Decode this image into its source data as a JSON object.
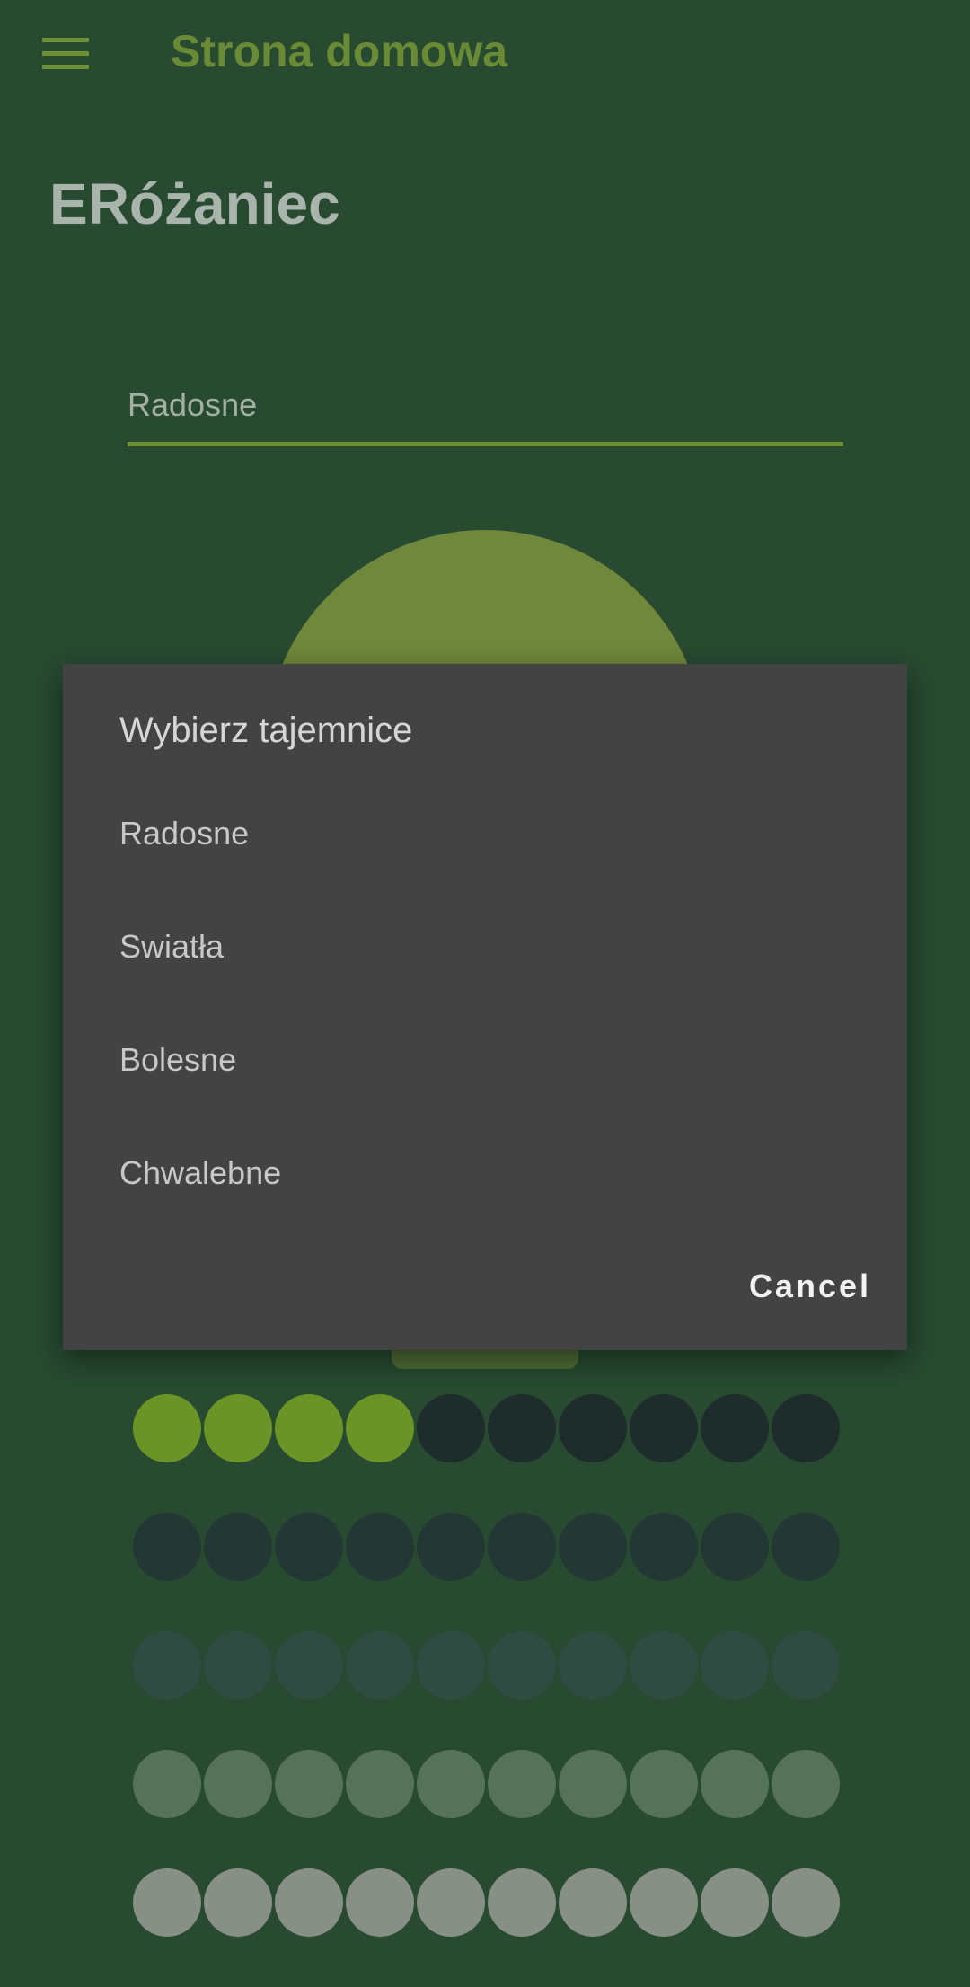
{
  "appbar": {
    "title": "Strona domowa",
    "menu_icon": "hamburger-menu-icon"
  },
  "page": {
    "title": "ERóżaniec"
  },
  "mystery_select": {
    "value": "Radosne"
  },
  "dialog": {
    "title": "Wybierz tajemnice",
    "options": [
      "Radosne",
      "Swiatła",
      "Bolesne",
      "Chwalebne"
    ],
    "cancel_label": "Cancel"
  },
  "beads": {
    "rows": 5,
    "per_row": 10,
    "completed_in_first_row": 4
  },
  "colors": {
    "background": "#274a30",
    "accent": "#6e8f33",
    "dialog_bg": "#434343",
    "bead_active": "#6a9426"
  }
}
